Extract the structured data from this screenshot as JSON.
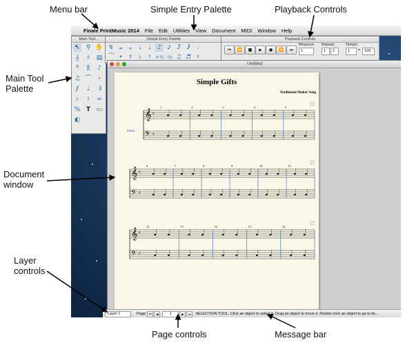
{
  "callouts": {
    "menu_bar": "Menu bar",
    "simple_entry_palette": "Simple Entry Palette",
    "playback_controls": "Playback Controls",
    "main_tool_palette": "Main Tool Palette",
    "document_window": "Document window",
    "layer_controls": "Layer controls",
    "page_controls": "Page controls",
    "message_bar": "Message bar"
  },
  "menubar": {
    "app_name": "Finale PrintMusic 2014",
    "items": [
      "File",
      "Edit",
      "Utilities",
      "View",
      "Document",
      "MIDI",
      "Window",
      "Help"
    ]
  },
  "palettes": {
    "main_tool_title": "Main Tool...",
    "simple_entry_title": "Simple Entry Palette",
    "playback_title": "Playback Controls"
  },
  "playback": {
    "measure_label": "Measure:",
    "measure_value": "1",
    "repeat_label": "Repeat:",
    "repeat_value": "1",
    "repeat_value_2": "1",
    "tempo_label": "Tempo:",
    "tempo_value": "1",
    "tempo_bpm": "120",
    "tempo_equals": "="
  },
  "document": {
    "window_title": "Untitled",
    "score_title": "Simple Gifts",
    "composer": "Traditional Shaker Song",
    "instrument": "Piano",
    "system_1_measures": [
      "1",
      "2",
      "3",
      "4",
      "5"
    ],
    "system_2_measures": [
      "6",
      "7",
      "8",
      "9",
      "10",
      "11"
    ],
    "system_3_measures": [
      "12",
      "13",
      "14",
      "15",
      "16"
    ]
  },
  "status": {
    "layer": "Layer 1",
    "page_label": "Page:",
    "page_value": "1",
    "message": "SELECTION TOOL: Click an object to select it. Drag an object to move it. Double-click an object to go to its..."
  },
  "colors": {
    "tool_blue": "#1b6fa8",
    "desktop": "#1e3f66",
    "paper": "#fbf7e8"
  }
}
